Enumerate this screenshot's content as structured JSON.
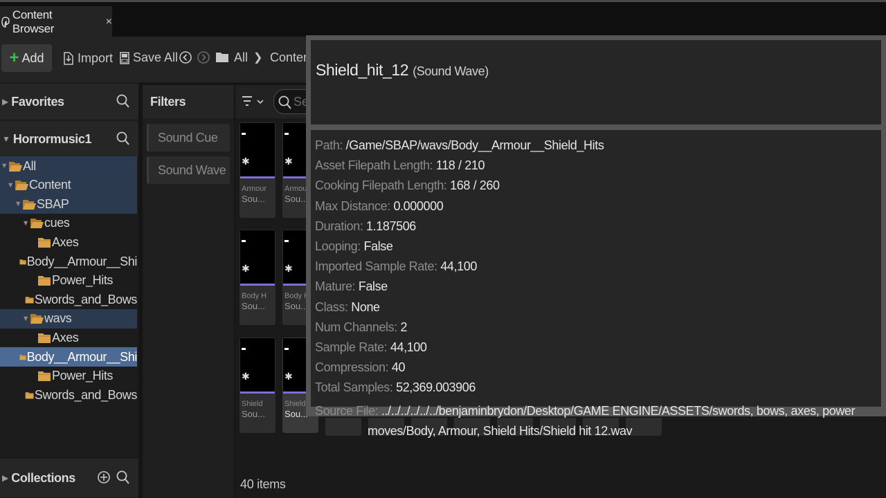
{
  "tab": {
    "title": "Content Browser",
    "close": "×"
  },
  "toolbar": {
    "add_label": "Add",
    "import_label": "Import",
    "saveall_label": "Save All",
    "breadcrumb": [
      "All",
      "Content"
    ]
  },
  "sidebar": {
    "favorites_label": "Favorites",
    "project_label": "Horrormusic1",
    "collections_label": "Collections",
    "tree": [
      {
        "label": "All",
        "depth": 0,
        "highlighted": true,
        "selected": false
      },
      {
        "label": "Content",
        "depth": 1,
        "highlighted": true,
        "selected": false
      },
      {
        "label": "SBAP",
        "depth": 2,
        "highlighted": true,
        "selected": false
      },
      {
        "label": "cues",
        "depth": 3,
        "highlighted": false,
        "selected": false
      },
      {
        "label": "Axes",
        "depth": 4,
        "highlighted": false,
        "selected": false
      },
      {
        "label": "Body__Armour__Shi",
        "depth": 4,
        "highlighted": false,
        "selected": false
      },
      {
        "label": "Power_Hits",
        "depth": 4,
        "highlighted": false,
        "selected": false
      },
      {
        "label": "Swords_and_Bows",
        "depth": 4,
        "highlighted": false,
        "selected": false
      },
      {
        "label": "wavs",
        "depth": 3,
        "highlighted": true,
        "selected": false
      },
      {
        "label": "Axes",
        "depth": 4,
        "highlighted": false,
        "selected": false
      },
      {
        "label": "Body__Armour__Shi",
        "depth": 4,
        "highlighted": false,
        "selected": true
      },
      {
        "label": "Power_Hits",
        "depth": 4,
        "highlighted": false,
        "selected": false
      },
      {
        "label": "Swords_and_Bows",
        "depth": 4,
        "highlighted": false,
        "selected": false
      }
    ]
  },
  "filters": {
    "title": "Filters",
    "chips": [
      "Sound Cue",
      "Sound Wave"
    ]
  },
  "grid": {
    "search_placeholder": "Se",
    "item_count": "40 items",
    "tiles": [
      {
        "line1": "Armour",
        "line2": "Sou..."
      },
      {
        "line1": "Armour",
        "line2": "Sou..."
      },
      {
        "line1": "Body H",
        "line2": "Sou..."
      },
      {
        "line1": "Body H",
        "line2": "Sou..."
      },
      {
        "line1": "Shield",
        "line2": "Sou..."
      },
      {
        "line1": "Shield",
        "line2": "Sou..."
      }
    ]
  },
  "tooltip": {
    "asset_name": "Shield_hit_12",
    "asset_class": "(Sound Wave)",
    "properties": [
      {
        "key": "Path:",
        "value": "/Game/SBAP/wavs/Body__Armour__Shield_Hits"
      },
      {
        "key": "Asset Filepath Length:",
        "value": "118 / 210"
      },
      {
        "key": "Cooking Filepath Length:",
        "value": "168 / 260"
      },
      {
        "key": "Max Distance:",
        "value": "0.000000"
      },
      {
        "key": "Duration:",
        "value": "1.187506"
      },
      {
        "key": "Looping:",
        "value": "False"
      },
      {
        "key": "Imported Sample Rate:",
        "value": "44,100"
      },
      {
        "key": "Mature:",
        "value": "False"
      },
      {
        "key": "Class:",
        "value": "None"
      },
      {
        "key": "Num Channels:",
        "value": "2"
      },
      {
        "key": "Sample Rate:",
        "value": "44,100"
      },
      {
        "key": "Compression:",
        "value": "40"
      },
      {
        "key": "Total Samples:",
        "value": "52,369.003906"
      },
      {
        "key": "Source File:",
        "value": "../../../../../../benjaminbrydon/Desktop/GAME ENGINE/ASSETS/swords, bows, axes, power moves/Body, Armour, Shield Hits/Shield hit 12.wav"
      }
    ]
  },
  "colors": {
    "selection": "#4d6a94",
    "folder": "#d9a24a",
    "add_plus": "#35c24a",
    "sound_wave_bar": "#7b6fe0"
  }
}
